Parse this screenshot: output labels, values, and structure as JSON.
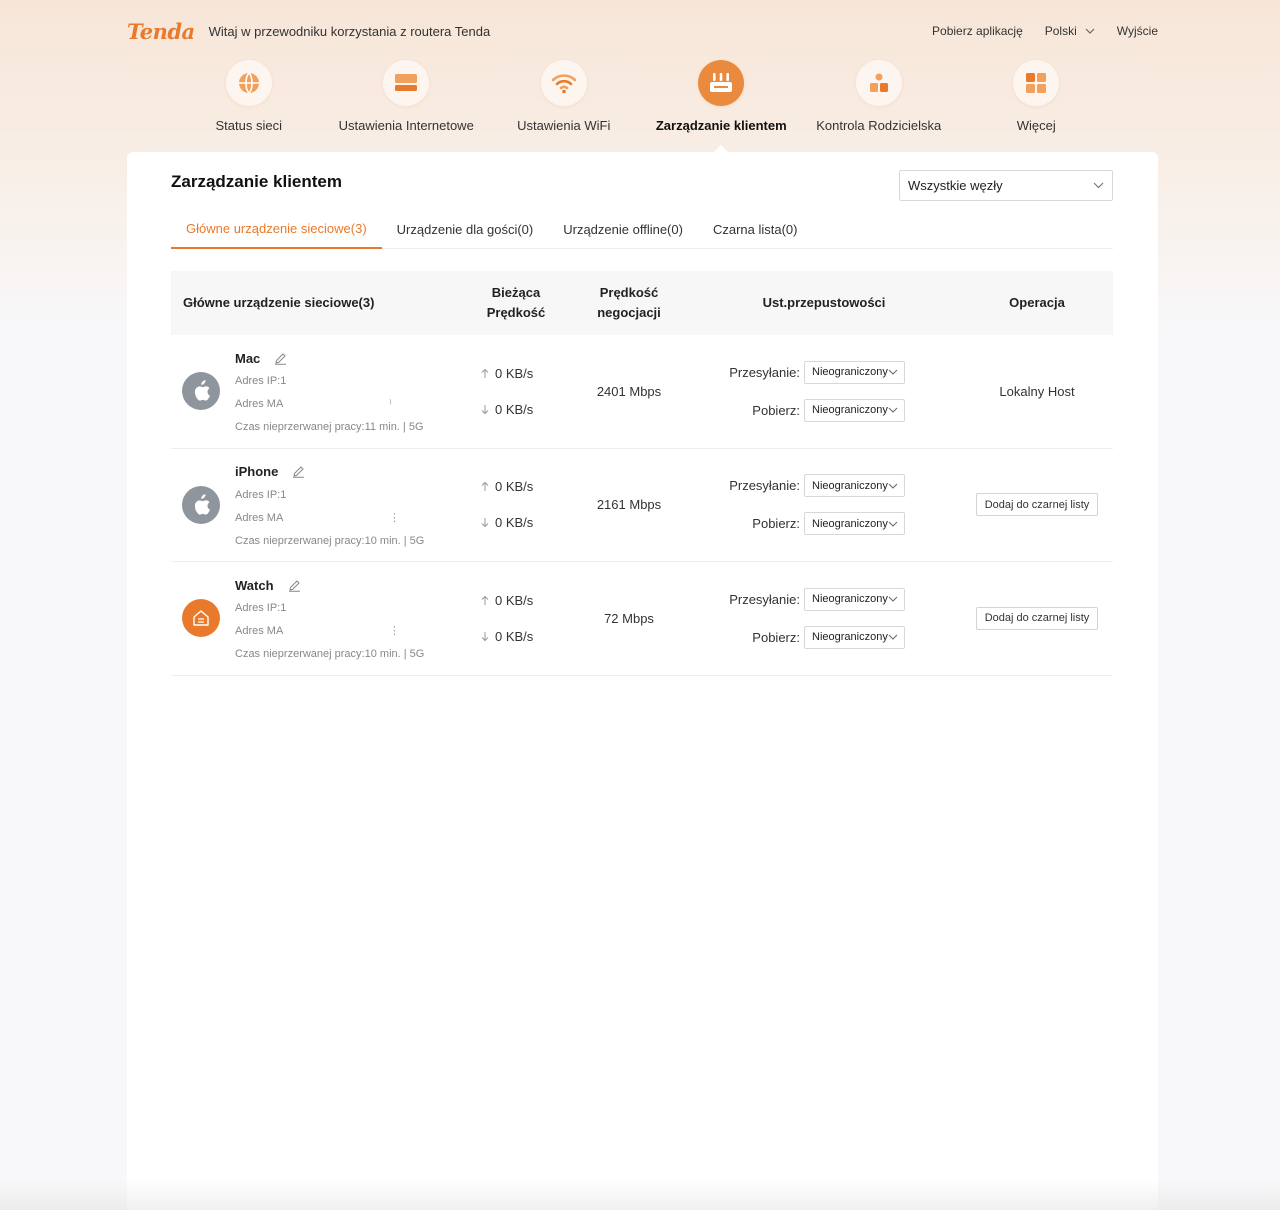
{
  "header": {
    "logo": "Tenda",
    "welcome": "Witaj w przewodniku korzystania z routera Tenda",
    "download_app": "Pobierz aplikację",
    "language": "Polski",
    "logout": "Wyjście"
  },
  "nav": [
    {
      "label": "Status sieci",
      "icon": "globe-icon",
      "active": false
    },
    {
      "label": "Ustawienia Internetowe",
      "icon": "internet-icon",
      "active": false
    },
    {
      "label": "Ustawienia WiFi",
      "icon": "wifi-icon",
      "active": false
    },
    {
      "label": "Zarządzanie klientem",
      "icon": "router-icon",
      "active": true
    },
    {
      "label": "Kontrola Rodzicielska",
      "icon": "parental-icon",
      "active": false
    },
    {
      "label": "Więcej",
      "icon": "grid-icon",
      "active": false
    }
  ],
  "page": {
    "title": "Zarządzanie klientem",
    "node_select": "Wszystkie węzły"
  },
  "tabs": [
    {
      "label": "Główne urządzenie sieciowe(3)",
      "active": true
    },
    {
      "label": "Urządzenie dla gości(0)",
      "active": false
    },
    {
      "label": "Urządzenie offline(0)",
      "active": false
    },
    {
      "label": "Czarna lista(0)",
      "active": false
    }
  ],
  "table": {
    "headers": {
      "device": "Główne urządzenie sieciowe(3)",
      "current_speed_1": "Bieżąca",
      "current_speed_2": "Prędkość",
      "nego_speed_1": "Prędkość",
      "nego_speed_2": "negocjacji",
      "bandwidth": "Ust.przepustowości",
      "operation": "Operacja"
    },
    "upload_label": "Przesyłanie:",
    "download_label": "Pobierz:",
    "rows": [
      {
        "name": "Mac",
        "icon": "apple-icon",
        "ip": "Adres IP:1",
        "mac": "Adres MA",
        "mac_tail": "⁾",
        "uptime": "Czas nieprzerwanej pracy:11 min.  | 5G",
        "up_speed": "0 KB/s",
        "down_speed": "0 KB/s",
        "nego": "2401 Mbps",
        "upload_limit": "Nieograniczony",
        "download_limit": "Nieograniczony",
        "operation": "Lokalny Host",
        "operation_is_button": false
      },
      {
        "name": "iPhone",
        "icon": "apple-icon",
        "ip": "Adres IP:1",
        "mac": "Adres MA",
        "mac_tail": "⋮",
        "uptime": "Czas nieprzerwanej pracy:10 min.  | 5G",
        "up_speed": "0 KB/s",
        "down_speed": "0 KB/s",
        "nego": "2161 Mbps",
        "upload_limit": "Nieograniczony",
        "download_limit": "Nieograniczony",
        "operation": "Dodaj do czarnej listy",
        "operation_is_button": true
      },
      {
        "name": "Watch",
        "icon": "home-icon",
        "ip": "Adres IP:1",
        "mac": "Adres MA",
        "mac_tail": "⋮",
        "uptime": "Czas nieprzerwanej pracy:10 min.  | 5G",
        "up_speed": "0 KB/s",
        "down_speed": "0 KB/s",
        "nego": "72 Mbps",
        "upload_limit": "Nieograniczony",
        "download_limit": "Nieograniczony",
        "operation": "Dodaj do czarnej listy",
        "operation_is_button": true
      }
    ]
  },
  "colors": {
    "accent": "#ea7a2b",
    "accent_light": "#ea8a3f",
    "device_gray": "#8f959d"
  }
}
